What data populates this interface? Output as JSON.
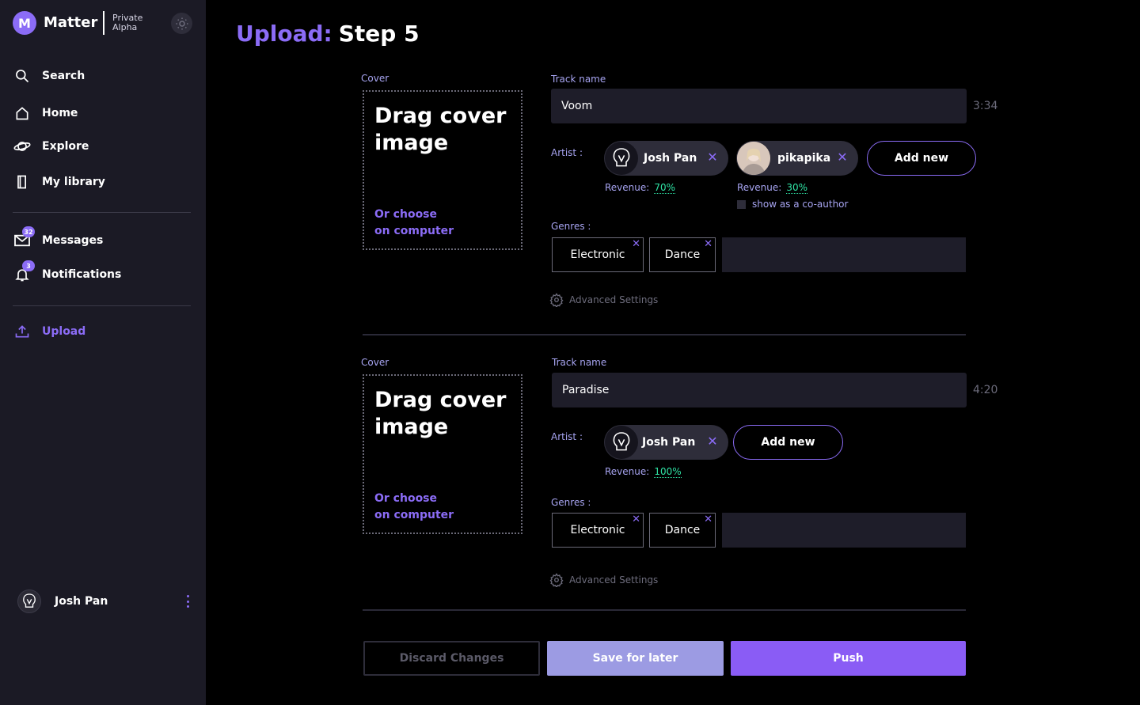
{
  "sidebar": {
    "logo_letter": "M",
    "brand": "Matter",
    "badge_line1": "Private",
    "badge_line2": "Alpha",
    "nav": [
      {
        "label": "Search",
        "icon": "search-icon"
      },
      {
        "label": "Home",
        "icon": "home-icon"
      },
      {
        "label": "Explore",
        "icon": "planet-icon"
      },
      {
        "label": "My library",
        "icon": "library-icon"
      }
    ],
    "messages": {
      "label": "Messages",
      "count": "32"
    },
    "notifications": {
      "label": "Notifications",
      "count": "3"
    },
    "upload": {
      "label": "Upload"
    },
    "user": {
      "name": "Josh Pan"
    }
  },
  "page": {
    "title_accent": "Upload:",
    "title_rest": "Step 5"
  },
  "tracks": [
    {
      "cover_label": "Cover",
      "cover_big": "Drag cover image",
      "cover_small_1": "Or choose",
      "cover_small_2": "on computer",
      "name_label": "Track name",
      "name": "Voom",
      "duration": "3:34",
      "artist_label": "Artist :",
      "artists": [
        {
          "name": "Josh Pan",
          "revenue_label": "Revenue:",
          "revenue": "70%"
        },
        {
          "name": "pikapika",
          "revenue_label": "Revenue:",
          "revenue": "30%"
        }
      ],
      "coauthor_label": "show as a co-author",
      "add_new": "Add new",
      "genres_label": "Genres :",
      "genres": [
        "Electronic",
        "Dance"
      ],
      "advanced": "Advanced Settings"
    },
    {
      "cover_label": "Cover",
      "cover_big": "Drag cover image",
      "cover_small_1": "Or choose",
      "cover_small_2": "on computer",
      "name_label": "Track name",
      "name": "Paradise",
      "duration": "4:20",
      "artist_label": "Artist :",
      "artists": [
        {
          "name": "Josh Pan",
          "revenue_label": "Revenue:",
          "revenue": "100%"
        }
      ],
      "add_new": "Add new",
      "genres_label": "Genres :",
      "genres": [
        "Electronic",
        "Dance"
      ],
      "advanced": "Advanced Settings"
    }
  ],
  "actions": {
    "discard": "Discard Changes",
    "save": "Save for later",
    "push": "Push"
  },
  "colors": {
    "accent": "#8b6cf6",
    "revenue": "#2fe4a5",
    "sidebar_bg": "#1b1a25",
    "save_button": "#9c9be3",
    "push_button": "#8a5cf5"
  }
}
